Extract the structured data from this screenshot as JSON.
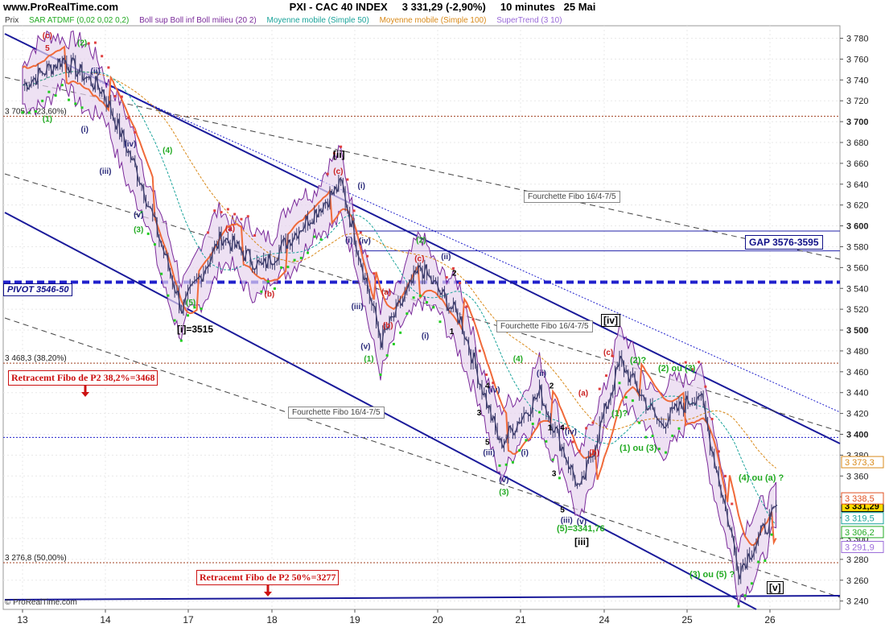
{
  "header": {
    "site": "www.ProRealTime.com",
    "title": "PXI - CAC 40 INDEX",
    "price": "3 331,29 (-2,90%)",
    "timeframe": "10 minutes",
    "date": "25 Mai"
  },
  "legend": [
    {
      "text": "Prix",
      "color": "#333333"
    },
    {
      "text": "SAR ATDMF (0,02 0,02 0,2)",
      "color": "#22aa22"
    },
    {
      "text": "Boll sup Boll inf Boll milieu (20 2)",
      "color": "#7a2a9a"
    },
    {
      "text": "Moyenne mobile (Simple 50)",
      "color": "#1aa39a"
    },
    {
      "text": "Moyenne mobile (Simple 100)",
      "color": "#d98a1a"
    },
    {
      "text": "SuperTrend (3 10)",
      "color": "#9a6ad9"
    }
  ],
  "footer": {
    "copyright": "© ProRealTime.com"
  },
  "chart_data": {
    "type": "candlestick",
    "title": "PXI - CAC 40 INDEX",
    "y_ticks": [
      3240,
      3260,
      3280,
      3300,
      3320,
      3340,
      3360,
      3380,
      3400,
      3420,
      3440,
      3460,
      3480,
      3500,
      3520,
      3540,
      3560,
      3580,
      3600,
      3620,
      3640,
      3660,
      3680,
      3700,
      3720,
      3740,
      3760,
      3780
    ],
    "x_ticks": [
      "13",
      "14",
      "17",
      "18",
      "19",
      "20",
      "21",
      "24",
      "25",
      "26"
    ],
    "ylim": [
      3232,
      3792
    ],
    "grid": true,
    "price_path": [
      {
        "x": "13",
        "y": 3735
      },
      {
        "x": "13",
        "y": 3760
      },
      {
        "x": "14",
        "y": 3730
      },
      {
        "x": "14",
        "y": 3640
      },
      {
        "x": "17",
        "y": 3520
      },
      {
        "x": "17",
        "y": 3590
      },
      {
        "x": "18",
        "y": 3560
      },
      {
        "x": "18",
        "y": 3600
      },
      {
        "x": "19",
        "y": 3640
      },
      {
        "x": "19",
        "y": 3490
      },
      {
        "x": "20",
        "y": 3560
      },
      {
        "x": "20",
        "y": 3510
      },
      {
        "x": "21",
        "y": 3390
      },
      {
        "x": "21",
        "y": 3440
      },
      {
        "x": "21",
        "y": 3345
      },
      {
        "x": "24",
        "y": 3470
      },
      {
        "x": "24",
        "y": 3410
      },
      {
        "x": "25",
        "y": 3440
      },
      {
        "x": "25",
        "y": 3270
      },
      {
        "x": "26",
        "y": 3331
      }
    ],
    "price_labels": [
      {
        "text": "3 331,29",
        "y": 3331.29,
        "bg": "#ffdd00",
        "color": "#000000"
      },
      {
        "text": "3 373,3",
        "y": 3373.3,
        "bg": "#ffffff",
        "color": "#d98a1a"
      },
      {
        "text": "3 338,5",
        "y": 3338.5,
        "bg": "#ffffff",
        "color": "#e05020"
      },
      {
        "text": "3 319,5",
        "y": 3319.5,
        "bg": "#ffffff",
        "color": "#1aa39a"
      },
      {
        "text": "3 306,2",
        "y": 3306.2,
        "bg": "#ffffff",
        "color": "#22aa22"
      },
      {
        "text": "3 291,9",
        "y": 3291.9,
        "bg": "#ffffff",
        "color": "#9a6ad9"
      }
    ],
    "levels": [
      {
        "y": 3705.2,
        "label": "3 705,2 (23,60%)",
        "color": "#a04020",
        "style": "dotted"
      },
      {
        "y": 3468.3,
        "label": "3 468,3 (38,20%)",
        "color": "#a04020",
        "style": "dotted"
      },
      {
        "y": 3276.8,
        "label": "3 276,8 (50,00%)",
        "color": "#a04020",
        "style": "dotted"
      },
      {
        "y": 3546,
        "label": "",
        "color": "#2020cc",
        "style": "thickdash"
      },
      {
        "y": 3397,
        "label": "",
        "color": "#2020cc",
        "style": "dotted"
      },
      {
        "y": 3595,
        "label": "",
        "color": "#2020aa",
        "style": "solid"
      },
      {
        "y": 3576,
        "label": "",
        "color": "#2020aa",
        "style": "solid"
      }
    ],
    "annotations": {
      "pivot": "PIVOT 3546-50",
      "gap": "GAP 3576-3595",
      "fibo_left_1": "Retracemt Fibo de P2 38,2%=3468",
      "fibo_left_2": "Retracemt Fibo de P2 50%=3277",
      "fourchette_1": "Fourchette Fibo 16/4-7/5",
      "fourchette_2": "Fourchette Fibo 16/4-7/5",
      "fourchette_3": "Fourchette Fibo 16/4-7/5",
      "wave_i": "[i]=3515",
      "wave_ii": "[ii]",
      "wave_iii": "[iii]",
      "wave_iv": "[iv]",
      "wave_v": "[v]",
      "wave_5_3341": "(5)=3341,76",
      "wave_1_or_3": "(1) ou (3)",
      "wave_2_or_3": "(2) ou (3)",
      "wave_4_or_a": "(4) ou (a) ?",
      "wave_3_or_5": "(3) ou (5) ?",
      "wave_2q": "(2)?",
      "wave_1q": "(1)?"
    },
    "small_labels": [
      {
        "t": "(c)",
        "xi": 0.3,
        "y": 3780,
        "c": "#cc2222"
      },
      {
        "t": "5",
        "xi": 0.3,
        "y": 3768,
        "c": "#cc2222"
      },
      {
        "t": "(2)",
        "xi": 0.72,
        "y": 3773,
        "c": "#22aa22"
      },
      {
        "t": "(ii)",
        "xi": 0.88,
        "y": 3746,
        "c": "#2a2a7a"
      },
      {
        "t": "(1)",
        "xi": 0.3,
        "y": 3700,
        "c": "#22aa22"
      },
      {
        "t": "(i)",
        "xi": 0.75,
        "y": 3690,
        "c": "#2a2a7a"
      },
      {
        "t": "(iv)",
        "xi": 1.3,
        "y": 3676,
        "c": "#2a2a7a"
      },
      {
        "t": "(iii)",
        "xi": 1.0,
        "y": 3650,
        "c": "#2a2a7a"
      },
      {
        "t": "(4)",
        "xi": 1.75,
        "y": 3670,
        "c": "#22aa22"
      },
      {
        "t": "(v)",
        "xi": 1.4,
        "y": 3608,
        "c": "#2a2a7a"
      },
      {
        "t": "(3)",
        "xi": 1.4,
        "y": 3594,
        "c": "#22aa22"
      },
      {
        "t": "(5)",
        "xi": 2.03,
        "y": 3524,
        "c": "#22aa22"
      },
      {
        "t": "(a)",
        "xi": 2.5,
        "y": 3595,
        "c": "#cc2222"
      },
      {
        "t": "(b)",
        "xi": 2.97,
        "y": 3532,
        "c": "#cc2222"
      },
      {
        "t": "(c)",
        "xi": 3.8,
        "y": 3650,
        "c": "#cc2222"
      },
      {
        "t": "(i)",
        "xi": 4.08,
        "y": 3636,
        "c": "#2a2a7a"
      },
      {
        "t": "(i)",
        "xi": 3.93,
        "y": 3584,
        "c": "#2a2a7a"
      },
      {
        "t": "(iv)",
        "xi": 4.12,
        "y": 3583,
        "c": "#2a2a7a"
      },
      {
        "t": "(iii)",
        "xi": 4.03,
        "y": 3520,
        "c": "#2a2a7a"
      },
      {
        "t": "(v)",
        "xi": 4.13,
        "y": 3482,
        "c": "#2a2a7a"
      },
      {
        "t": "(1)",
        "xi": 4.17,
        "y": 3470,
        "c": "#22aa22"
      },
      {
        "t": "(a)",
        "xi": 4.38,
        "y": 3534,
        "c": "#cc2222"
      },
      {
        "t": "(b)",
        "xi": 4.4,
        "y": 3502,
        "c": "#cc2222"
      },
      {
        "t": "(2)",
        "xi": 4.8,
        "y": 3584,
        "c": "#22aa22"
      },
      {
        "t": "(c)",
        "xi": 4.78,
        "y": 3566,
        "c": "#cc2222"
      },
      {
        "t": "(ii)",
        "xi": 5.1,
        "y": 3568,
        "c": "#2a2a7a"
      },
      {
        "t": "2",
        "xi": 5.2,
        "y": 3552,
        "c": "#000000"
      },
      {
        "t": "(i)",
        "xi": 4.85,
        "y": 3492,
        "c": "#2a2a7a"
      },
      {
        "t": "1",
        "xi": 5.17,
        "y": 3496,
        "c": "#000000"
      },
      {
        "t": "(4)",
        "xi": 5.97,
        "y": 3470,
        "c": "#22aa22"
      },
      {
        "t": "4",
        "xi": 5.6,
        "y": 3444,
        "c": "#000000"
      },
      {
        "t": "(iv)",
        "xi": 5.68,
        "y": 3440,
        "c": "#2a2a7a"
      },
      {
        "t": "3",
        "xi": 5.5,
        "y": 3418,
        "c": "#000000"
      },
      {
        "t": "5",
        "xi": 5.6,
        "y": 3390,
        "c": "#000000"
      },
      {
        "t": "(iii)",
        "xi": 5.62,
        "y": 3380,
        "c": "#2a2a7a"
      },
      {
        "t": "(i)",
        "xi": 6.05,
        "y": 3380,
        "c": "#2a2a7a"
      },
      {
        "t": "(v)",
        "xi": 5.8,
        "y": 3354,
        "c": "#2a2a7a"
      },
      {
        "t": "(3)",
        "xi": 5.8,
        "y": 3342,
        "c": "#22aa22"
      },
      {
        "t": "(ii)",
        "xi": 6.25,
        "y": 3456,
        "c": "#2a2a7a"
      },
      {
        "t": "2",
        "xi": 6.37,
        "y": 3444,
        "c": "#000000"
      },
      {
        "t": "1",
        "xi": 6.35,
        "y": 3404,
        "c": "#000000"
      },
      {
        "t": "4",
        "xi": 6.5,
        "y": 3404,
        "c": "#000000"
      },
      {
        "t": "(iv)",
        "xi": 6.6,
        "y": 3400,
        "c": "#2a2a7a"
      },
      {
        "t": "3",
        "xi": 6.4,
        "y": 3360,
        "c": "#000000"
      },
      {
        "t": "5",
        "xi": 6.5,
        "y": 3325,
        "c": "#000000"
      },
      {
        "t": "(iii)",
        "xi": 6.55,
        "y": 3315,
        "c": "#2a2a7a"
      },
      {
        "t": "(v)",
        "xi": 6.73,
        "y": 3314,
        "c": "#2a2a7a"
      },
      {
        "t": "(a)",
        "xi": 6.75,
        "y": 3437,
        "c": "#cc2222"
      },
      {
        "t": "(b)",
        "xi": 6.88,
        "y": 3380,
        "c": "#cc2222"
      },
      {
        "t": "(c)",
        "xi": 7.05,
        "y": 3476,
        "c": "#cc2222"
      }
    ]
  }
}
